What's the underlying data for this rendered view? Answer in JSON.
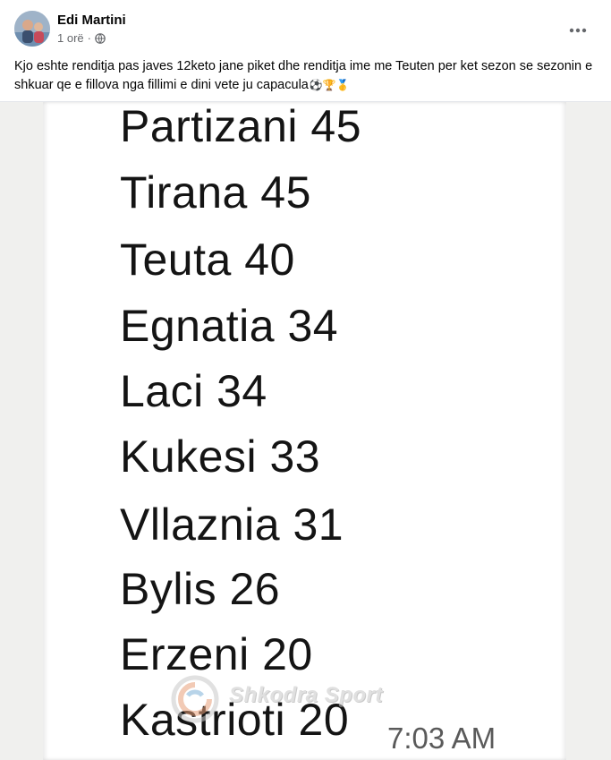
{
  "post": {
    "author": "Edi Martini",
    "time": "1 orë",
    "privacy_icon": "globe-icon",
    "more_icon": "more-options-icon",
    "caption": "Kjo eshte renditja pas javes 12keto jane piket dhe renditja  ime me Teuten per ket sezon se sezonin e shkuar qe e fillova nga fillimi e dini vete ju capacula",
    "caption_emojis": "⚽🏆🥇"
  },
  "photo": {
    "standings": [
      {
        "text": "Partizani 45"
      },
      {
        "text": "Tirana 45"
      },
      {
        "text": "Teuta 40"
      },
      {
        "text": "Egnatia 34"
      },
      {
        "text": "Laci 34"
      },
      {
        "text": "Kukesi 33"
      },
      {
        "text": "Vllaznia 31"
      },
      {
        "text": "Bylis 26"
      },
      {
        "text": "Erzeni 20"
      },
      {
        "text": "Kastrioti 20"
      }
    ],
    "timestamp": "7:03 AM",
    "watermark": "Shkodra Sport"
  }
}
